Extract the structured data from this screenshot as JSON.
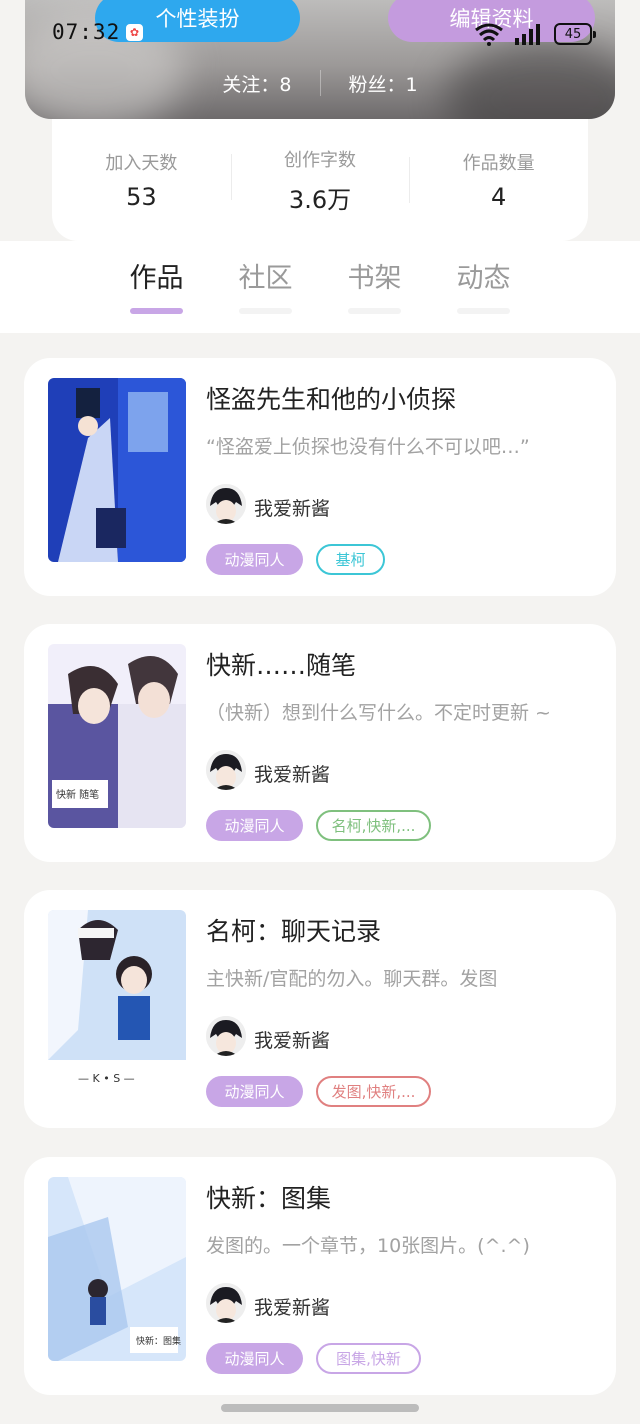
{
  "status_bar": {
    "time": "07:32",
    "battery": "45",
    "icons": [
      "app-notification-icon",
      "wifi-icon",
      "signal-icon",
      "battery-icon"
    ]
  },
  "header": {
    "dress_up_label": "个性装扮",
    "edit_profile_label": "编辑资料",
    "following": "关注：8",
    "followers": "粉丝：1"
  },
  "stats": [
    {
      "label": "加入天数",
      "value": "53"
    },
    {
      "label": "创作字数",
      "value": "3.6万"
    },
    {
      "label": "作品数量",
      "value": "4"
    }
  ],
  "tabs": [
    {
      "label": "作品",
      "active": true
    },
    {
      "label": "社区",
      "active": false
    },
    {
      "label": "书架",
      "active": false
    },
    {
      "label": "动态",
      "active": false
    }
  ],
  "works": [
    {
      "title": "怪盗先生和他的小侦探",
      "desc": "“怪盗爱上侦探也没有什么不可以吧…”",
      "author": "我爱新酱",
      "category": "动漫同人",
      "tags": "基柯",
      "tag_color": "#3cc6d6"
    },
    {
      "title": "快新……随笔",
      "desc": "（快新）想到什么写什么。不定时更新 ~",
      "author": "我爱新酱",
      "category": "动漫同人",
      "tags": "名柯,快新,...",
      "tag_color": "#7fc07e"
    },
    {
      "title": "名柯：聊天记录",
      "desc": "主快新/官配的勿入。聊天群。发图",
      "author": "我爱新酱",
      "category": "动漫同人",
      "tags": "发图,快新,...",
      "tag_color": "#e08080"
    },
    {
      "title": "快新：图集",
      "desc": "发图的。一个章节，10张图片。(^.^)",
      "author": "我爱新酱",
      "category": "动漫同人",
      "tags": "图集,快新",
      "tag_color": "#c8a6e6"
    }
  ],
  "colors": {
    "accent_purple": "#c8a6e6",
    "blue_button": "#2ea8ee",
    "page_bg": "#f4f3f1"
  }
}
